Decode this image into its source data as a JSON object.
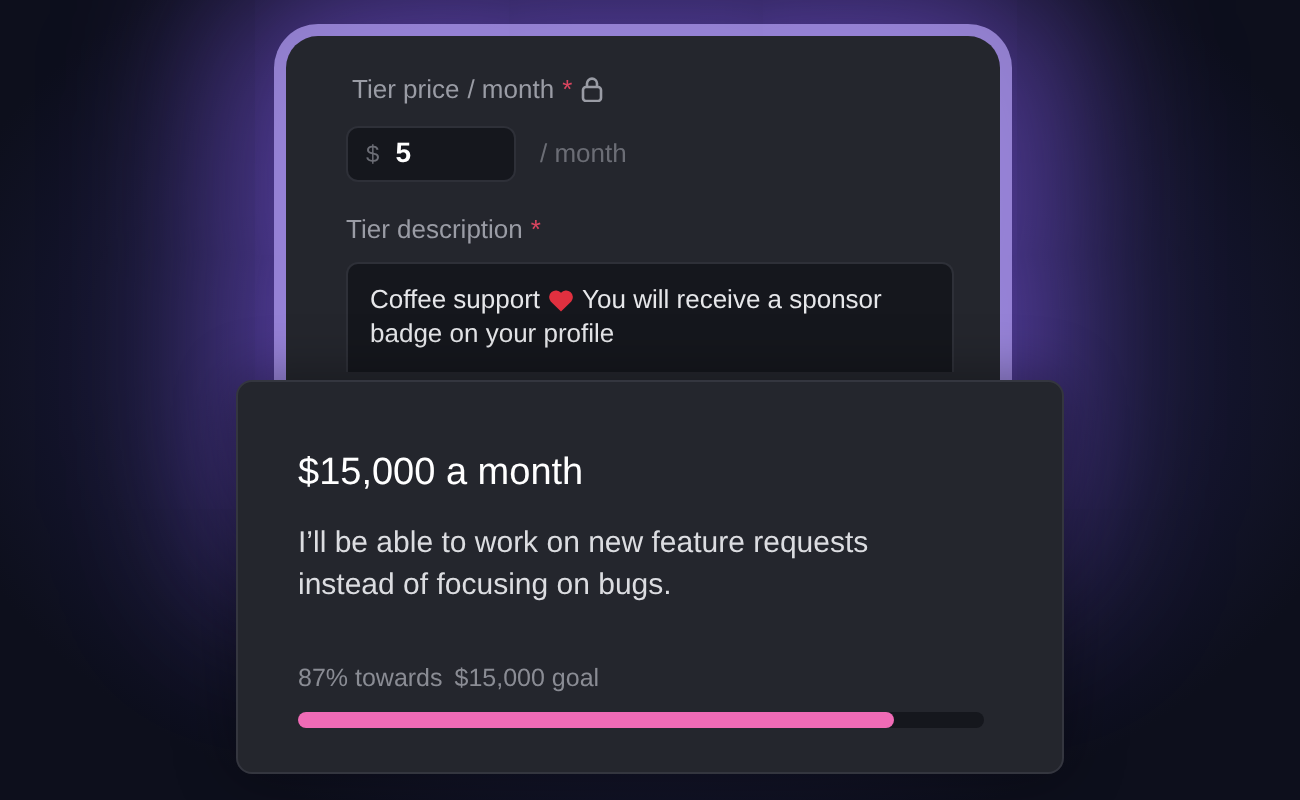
{
  "tier_form": {
    "price_label": "Tier price",
    "price_unit_label": "/ month",
    "required_mark": "*",
    "currency": "$",
    "price_value": "5",
    "price_suffix": "/ month",
    "description_label": "Tier description",
    "description_required_mark": "*",
    "description_before_icon": "Coffee support",
    "description_after_icon": "You will receive a sponsor",
    "description_second_line": "badge on your profile"
  },
  "goal_card": {
    "title": "$15,000 a month",
    "text": "I’ll be able to work on new feature requests instead of focusing on bugs.",
    "progress_percent": "87% towards",
    "progress_goal": "$15,000 goal",
    "level": 0.87
  }
}
